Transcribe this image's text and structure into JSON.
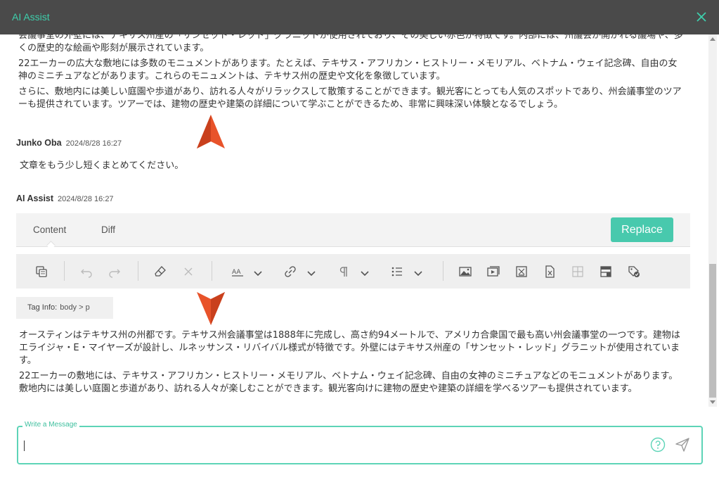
{
  "window": {
    "title": "AI Assist"
  },
  "history": {
    "prev_ai_text": [
      "会議事堂の外壁には、テキサス州産の「サンセット・レッド」グラニットが使用されており、その美しい赤色が特徴です。内部には、州議会が開かれる議場や、多くの歴史的な絵画や彫刻が展示されています。",
      "22エーカーの広大な敷地には多数のモニュメントがあります。たとえば、テキサス・アフリカン・ヒストリー・メモリアル、ベトナム・ウェイ記念碑、自由の女神のミニチュアなどがあります。これらのモニュメントは、テキサス州の歴史や文化を象徴しています。",
      "さらに、敷地内には美しい庭園や歩道があり、訪れる人々がリラックスして散策することができます。観光客にとっても人気のスポットであり、州会議事堂のツアーも提供されています。ツアーでは、建物の歴史や建築の詳細について学ぶことができるため、非常に興味深い体験となるでしょう。"
    ],
    "user": {
      "name": "Junko Oba",
      "timestamp": "2024/8/28 16:27",
      "message": "文章をもう少し短くまとめてください。"
    },
    "ai": {
      "name": "AI Assist",
      "timestamp": "2024/8/28 16:27"
    }
  },
  "editor": {
    "tabs": [
      {
        "label": "Content"
      },
      {
        "label": "Diff"
      }
    ],
    "replace_label": "Replace",
    "tag_info": {
      "label": "Tag Info:",
      "path": "body > p"
    },
    "toolbar_icons": [
      "template-icon",
      "undo-icon",
      "redo-icon",
      "eraser-icon",
      "close-icon",
      "font-size-icon",
      "link-icon",
      "paragraph-icon",
      "list-icon",
      "image-icon",
      "video-icon",
      "text-block-icon",
      "file-icon",
      "table-icon",
      "layout-icon",
      "tag-check-icon"
    ],
    "output": [
      "オースティンはテキサス州の州都です。テキサス州会議事堂は1888年に完成し、高さ約94メートルで、アメリカ合衆国で最も高い州会議事堂の一つです。建物はエライジャ・E・マイヤーズが設計し、ルネッサンス・リバイバル様式が特徴です。外壁にはテキサス州産の「サンセット・レッド」グラニットが使用されています。",
      "22エーカーの敷地には、テキサス・アフリカン・ヒストリー・メモリアル、ベトナム・ウェイ記念碑、自由の女神のミニチュアなどのモニュメントがあります。敷地内には美しい庭園と歩道があり、訪れる人々が楽しむことができます。観光客向けに建物の歴史や建築の詳細を学べるツアーも提供されています。"
    ]
  },
  "composer": {
    "label": "Write a Message",
    "value": ""
  },
  "colors": {
    "accent": "#48c9ad",
    "titlebar": "#4a4a4a",
    "marker": "#e8532a"
  }
}
